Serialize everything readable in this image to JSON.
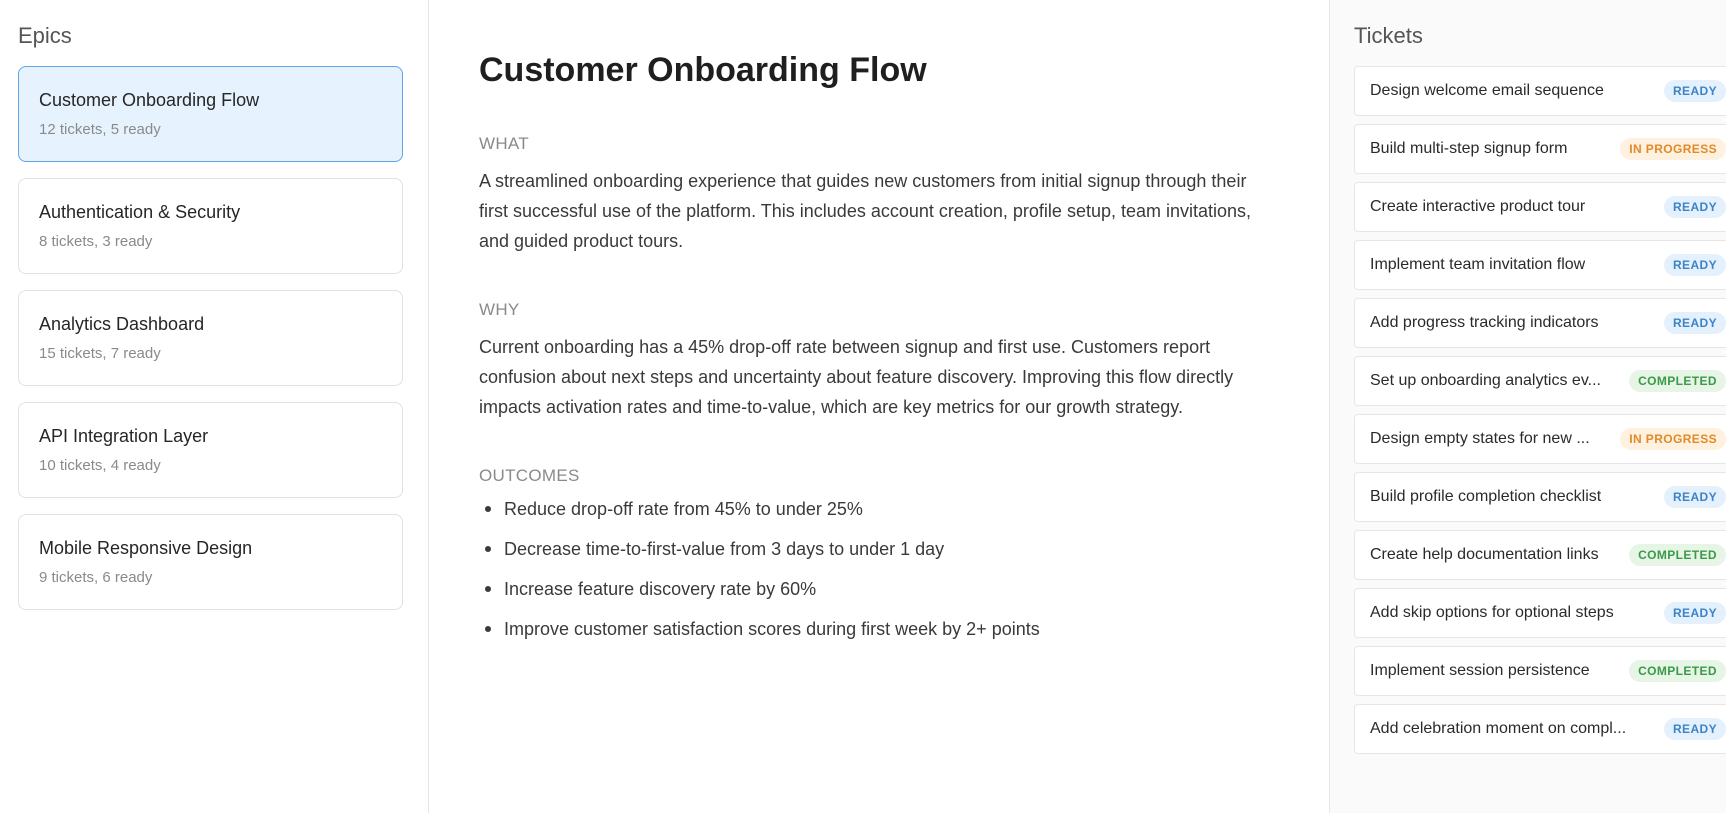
{
  "epics": {
    "title": "Epics",
    "items": [
      {
        "name": "Customer Onboarding Flow",
        "meta": "12 tickets, 5 ready",
        "active": true
      },
      {
        "name": "Authentication & Security",
        "meta": "8 tickets, 3 ready",
        "active": false
      },
      {
        "name": "Analytics Dashboard",
        "meta": "15 tickets, 7 ready",
        "active": false
      },
      {
        "name": "API Integration Layer",
        "meta": "10 tickets, 4 ready",
        "active": false
      },
      {
        "name": "Mobile Responsive Design",
        "meta": "9 tickets, 6 ready",
        "active": false
      }
    ]
  },
  "detail": {
    "title": "Customer Onboarding Flow",
    "what_label": "WHAT",
    "what_text": "A streamlined onboarding experience that guides new customers from initial signup through their first successful use of the platform. This includes account creation, profile setup, team invitations, and guided product tours.",
    "why_label": "WHY",
    "why_text": "Current onboarding has a 45% drop-off rate between signup and first use. Customers report confusion about next steps and uncertainty about feature discovery. Improving this flow directly impacts activation rates and time-to-value, which are key metrics for our growth strategy.",
    "outcomes_label": "OUTCOMES",
    "outcomes": [
      "Reduce drop-off rate from 45% to under 25%",
      "Decrease time-to-first-value from 3 days to under 1 day",
      "Increase feature discovery rate by 60%",
      "Improve customer satisfaction scores during first week by 2+ points"
    ]
  },
  "tickets": {
    "title": "Tickets",
    "items": [
      {
        "title": "Design welcome email sequence",
        "status": "READY",
        "kind": "ready"
      },
      {
        "title": "Build multi-step signup form",
        "status": "IN PROGRESS",
        "kind": "progress"
      },
      {
        "title": "Create interactive product tour",
        "status": "READY",
        "kind": "ready"
      },
      {
        "title": "Implement team invitation flow",
        "status": "READY",
        "kind": "ready"
      },
      {
        "title": "Add progress tracking indicators",
        "status": "READY",
        "kind": "ready"
      },
      {
        "title": "Set up onboarding analytics ev...",
        "status": "COMPLETED",
        "kind": "completed"
      },
      {
        "title": "Design empty states for new ...",
        "status": "IN PROGRESS",
        "kind": "progress"
      },
      {
        "title": "Build profile completion checklist",
        "status": "READY",
        "kind": "ready"
      },
      {
        "title": "Create help documentation links",
        "status": "COMPLETED",
        "kind": "completed"
      },
      {
        "title": "Add skip options for optional steps",
        "status": "READY",
        "kind": "ready"
      },
      {
        "title": "Implement session persistence",
        "status": "COMPLETED",
        "kind": "completed"
      },
      {
        "title": "Add celebration moment on compl...",
        "status": "READY",
        "kind": "ready"
      }
    ]
  },
  "colors": {
    "active_epic_bg": "#e6f3fe",
    "active_epic_border": "#5ea6e4",
    "ready": "#3d83c5",
    "in_progress": "#e08a28",
    "completed": "#3b9a48"
  }
}
